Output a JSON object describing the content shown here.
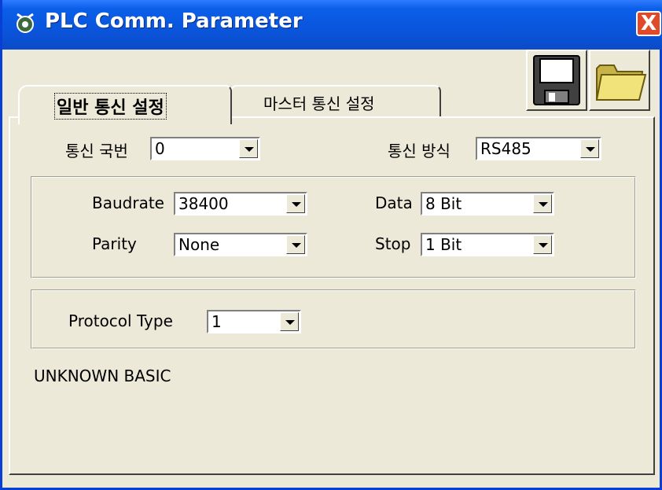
{
  "window": {
    "title": "PLC Comm. Parameter",
    "close_label": "X"
  },
  "toolbar": {
    "save_icon": "save-disk-icon",
    "open_icon": "open-folder-icon"
  },
  "tabs": [
    {
      "label": "일반 통신 설정",
      "active": true
    },
    {
      "label": "마스터 통신 설정",
      "active": false
    }
  ],
  "general": {
    "station_label": "통신 국번",
    "station_value": "0",
    "method_label": "통신 방식",
    "method_value": "RS485",
    "baudrate_label": "Baudrate",
    "baudrate_value": "38400",
    "data_label": "Data",
    "data_value": "8 Bit",
    "parity_label": "Parity",
    "parity_value": "None",
    "stop_label": "Stop",
    "stop_value": "1 Bit",
    "protocol_label": "Protocol Type",
    "protocol_value": "1",
    "status_text": "UNKNOWN BASIC"
  }
}
